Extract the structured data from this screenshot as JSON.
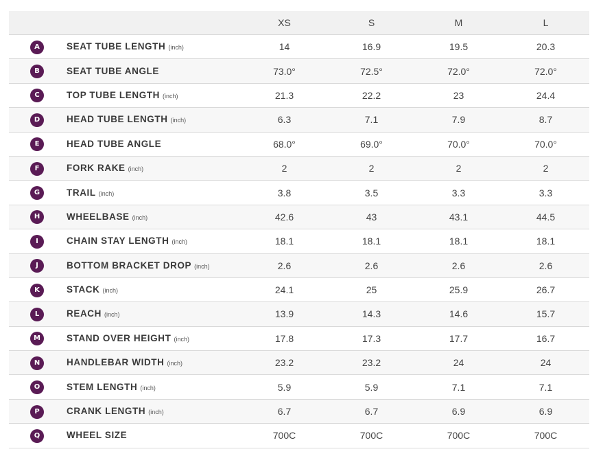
{
  "sizes": [
    "XS",
    "S",
    "M",
    "L"
  ],
  "rows": [
    {
      "letter": "A",
      "name": "SEAT TUBE LENGTH",
      "unit": "(inch)",
      "values": [
        "14",
        "16.9",
        "19.5",
        "20.3"
      ]
    },
    {
      "letter": "B",
      "name": "SEAT TUBE ANGLE",
      "unit": "",
      "values": [
        "73.0°",
        "72.5°",
        "72.0°",
        "72.0°"
      ]
    },
    {
      "letter": "C",
      "name": "TOP TUBE LENGTH",
      "unit": "(inch)",
      "values": [
        "21.3",
        "22.2",
        "23",
        "24.4"
      ]
    },
    {
      "letter": "D",
      "name": "HEAD TUBE LENGTH",
      "unit": "(inch)",
      "values": [
        "6.3",
        "7.1",
        "7.9",
        "8.7"
      ]
    },
    {
      "letter": "E",
      "name": "HEAD TUBE ANGLE",
      "unit": "",
      "values": [
        "68.0°",
        "69.0°",
        "70.0°",
        "70.0°"
      ]
    },
    {
      "letter": "F",
      "name": "FORK RAKE",
      "unit": "(inch)",
      "values": [
        "2",
        "2",
        "2",
        "2"
      ]
    },
    {
      "letter": "G",
      "name": "TRAIL",
      "unit": "(inch)",
      "values": [
        "3.8",
        "3.5",
        "3.3",
        "3.3"
      ]
    },
    {
      "letter": "H",
      "name": "WHEELBASE",
      "unit": "(inch)",
      "values": [
        "42.6",
        "43",
        "43.1",
        "44.5"
      ]
    },
    {
      "letter": "I",
      "name": "CHAIN STAY LENGTH",
      "unit": "(inch)",
      "values": [
        "18.1",
        "18.1",
        "18.1",
        "18.1"
      ]
    },
    {
      "letter": "J",
      "name": "BOTTOM BRACKET DROP",
      "unit": "(inch)",
      "values": [
        "2.6",
        "2.6",
        "2.6",
        "2.6"
      ]
    },
    {
      "letter": "K",
      "name": "STACK",
      "unit": "(inch)",
      "values": [
        "24.1",
        "25",
        "25.9",
        "26.7"
      ]
    },
    {
      "letter": "L",
      "name": "REACH",
      "unit": "(inch)",
      "values": [
        "13.9",
        "14.3",
        "14.6",
        "15.7"
      ]
    },
    {
      "letter": "M",
      "name": "STAND OVER HEIGHT",
      "unit": "(inch)",
      "values": [
        "17.8",
        "17.3",
        "17.7",
        "16.7"
      ]
    },
    {
      "letter": "N",
      "name": "HANDLEBAR WIDTH",
      "unit": "(inch)",
      "values": [
        "23.2",
        "23.2",
        "24",
        "24"
      ]
    },
    {
      "letter": "O",
      "name": "STEM LENGTH",
      "unit": "(inch)",
      "values": [
        "5.9",
        "5.9",
        "7.1",
        "7.1"
      ]
    },
    {
      "letter": "P",
      "name": "CRANK LENGTH",
      "unit": "(inch)",
      "values": [
        "6.7",
        "6.7",
        "6.9",
        "6.9"
      ]
    },
    {
      "letter": "Q",
      "name": "WHEEL SIZE",
      "unit": "",
      "values": [
        "700C",
        "700C",
        "700C",
        "700C"
      ]
    }
  ],
  "colors": {
    "badge": "#5a1b55",
    "header_bg": "#f1f1f1",
    "stripe_bg": "#f7f7f7",
    "row_border": "#d9d9d9"
  }
}
